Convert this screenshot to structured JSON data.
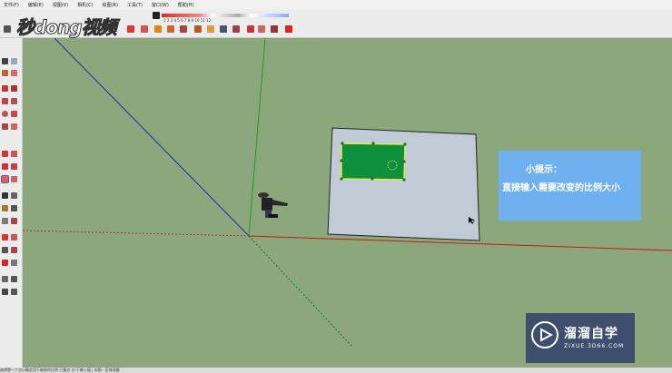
{
  "menu": {
    "items": [
      "文件(F)",
      "编辑(E)",
      "视图(V)",
      "相机(C)",
      "绘图(R)",
      "工具(T)",
      "窗口(W)",
      "帮助(H)"
    ]
  },
  "logo": {
    "text": "秒dong视频"
  },
  "shadow_settings": {
    "numbers": "1 2 3 4 5 6 7 8 9 10 11 12",
    "times": "06:43    中午    17:30"
  },
  "tip": {
    "title": "小提示：",
    "text": "直接输入需要改变的比例大小"
  },
  "brand": {
    "name": "溜溜自学",
    "url": "ZIXUE.3D66.COM"
  },
  "statusbar": {
    "text": "选择第一个点以确定用于缩放的比例    已量点 |小于输入值  |   如图—区域测量"
  },
  "icons": {
    "toolbar": [
      "select-icon",
      "eraser-icon",
      "paint-icon",
      "move-icon",
      "rotate-icon",
      "scale-icon",
      "pushpull-icon",
      "offset-icon",
      "tape-icon",
      "text-icon",
      "orbit-icon",
      "pan-icon",
      "zoom-icon",
      "zoom-extents-icon",
      "walk-icon",
      "section-icon"
    ],
    "colors": {
      "background": "#8da77d",
      "plane": "#c0cbd6",
      "image": "#0e8f3c",
      "tip": "#6fb0f0",
      "brand": "#3e4f6e"
    }
  }
}
